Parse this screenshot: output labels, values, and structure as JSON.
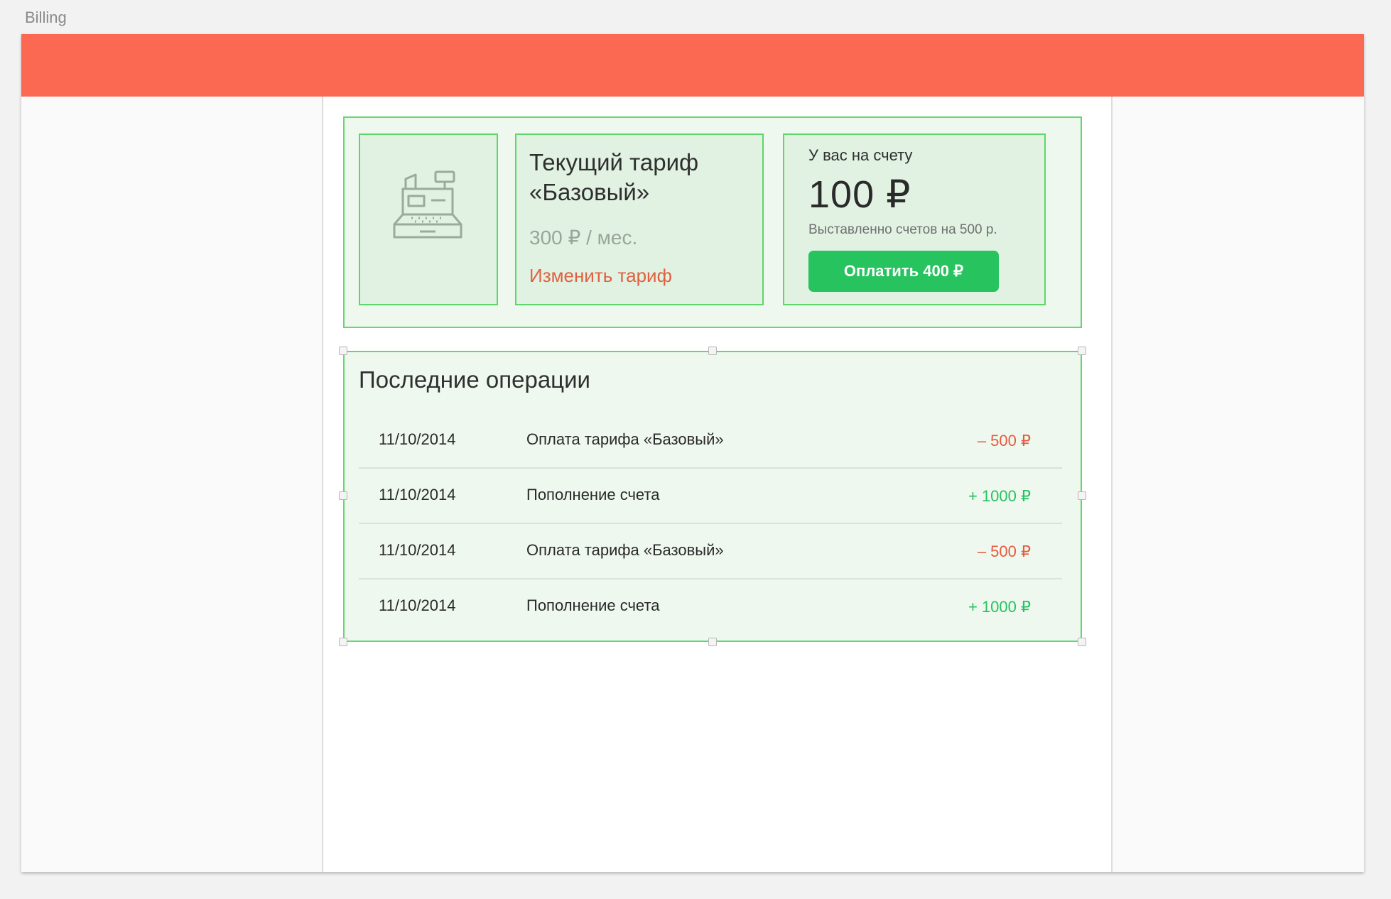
{
  "window": {
    "title": "Billing"
  },
  "colors": {
    "header": "#fc6952",
    "accent_green": "#27c35f",
    "border_green": "#64d86e",
    "link_orange": "#e0613f"
  },
  "tariff": {
    "icon": "cash-register-icon",
    "title": "Текущий тариф «Базовый»",
    "price": "300 ₽ / мес.",
    "change_link": "Изменить тариф"
  },
  "balance": {
    "label": "У вас на счету",
    "amount": "100 ₽",
    "invoiced": "Выставленно счетов на 500 р.",
    "pay_button": "Оплатить 400 ₽"
  },
  "operations": {
    "title": "Последние операции",
    "rows": [
      {
        "date": "11/10/2014",
        "description": "Оплата тарифа «Базовый»",
        "amount": "– 500 ₽",
        "kind": "neg"
      },
      {
        "date": "11/10/2014",
        "description": "Пополнение счета",
        "amount": "+ 1000 ₽",
        "kind": "pos"
      },
      {
        "date": "11/10/2014",
        "description": "Оплата тарифа «Базовый»",
        "amount": "– 500 ₽",
        "kind": "neg"
      },
      {
        "date": "11/10/2014",
        "description": "Пополнение счета",
        "amount": "+ 1000 ₽",
        "kind": "pos"
      }
    ]
  }
}
